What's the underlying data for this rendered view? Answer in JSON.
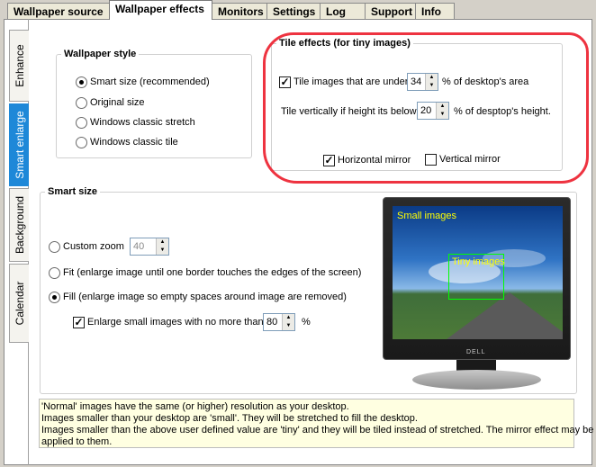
{
  "tabs": [
    {
      "label": "Wallpaper source",
      "active": false
    },
    {
      "label": "Wallpaper effects",
      "active": true
    },
    {
      "label": "Monitors",
      "active": false
    },
    {
      "label": "Settings",
      "active": false
    },
    {
      "label": "Log",
      "active": false
    },
    {
      "label": "Support",
      "active": false
    },
    {
      "label": "Info",
      "active": false
    }
  ],
  "side_tabs": [
    {
      "label": "Enhance",
      "active": false
    },
    {
      "label": "Smart enlarge",
      "active": true
    },
    {
      "label": "Background",
      "active": false
    },
    {
      "label": "Calendar",
      "active": false
    }
  ],
  "wallpaper_style": {
    "title": "Wallpaper style",
    "options": [
      {
        "label": "Smart size (recommended)",
        "selected": true
      },
      {
        "label": "Original size",
        "selected": false
      },
      {
        "label": "Windows classic stretch",
        "selected": false
      },
      {
        "label": "Windows classic tile",
        "selected": false
      }
    ]
  },
  "tile_effects": {
    "title": "Tile effects (for tiny images)",
    "tile_under_checked": true,
    "tile_under_label": "Tile images that are under",
    "tile_under_value": "34",
    "tile_under_suffix": "% of desktop's area",
    "tile_vert_label": "Tile vertically if height its below",
    "tile_vert_value": "20",
    "tile_vert_suffix": "% of desptop's height.",
    "horizontal_mirror_label": "Horizontal mirror",
    "horizontal_mirror_checked": true,
    "vertical_mirror_label": "Vertical mirror",
    "vertical_mirror_checked": false
  },
  "smart_size": {
    "title": "Smart size",
    "custom_zoom_label": "Custom zoom",
    "custom_zoom_value": "40",
    "fit_label": "Fit (enlarge image until one border touches the edges of the screen)",
    "fill_label": "Fill (enlarge image so empty spaces around image are removed)",
    "selected": "fill",
    "enlarge_small_label": "Enlarge small images with no more than",
    "enlarge_small_value": "80",
    "enlarge_small_checked": true,
    "enlarge_small_suffix": "%"
  },
  "preview": {
    "small_images_label": "Small images",
    "tiny_images_label": "Tiny images",
    "small_label_color": "#ffff00",
    "tiny_label_color": "#ffff00",
    "tiny_box_color": "#00ff00",
    "logo_text": "DELL"
  },
  "info": {
    "lines": [
      "'Normal' images have the same (or higher) resolution as your desktop.",
      "Images smaller than your desktop are 'small'. They will be stretched to fill the desktop.",
      "Images smaller than the above user defined value are 'tiny' and they will be tiled instead of stretched. The mirror effect may be",
      "applied to them."
    ]
  },
  "annotation": {
    "color": "#ee3340"
  }
}
